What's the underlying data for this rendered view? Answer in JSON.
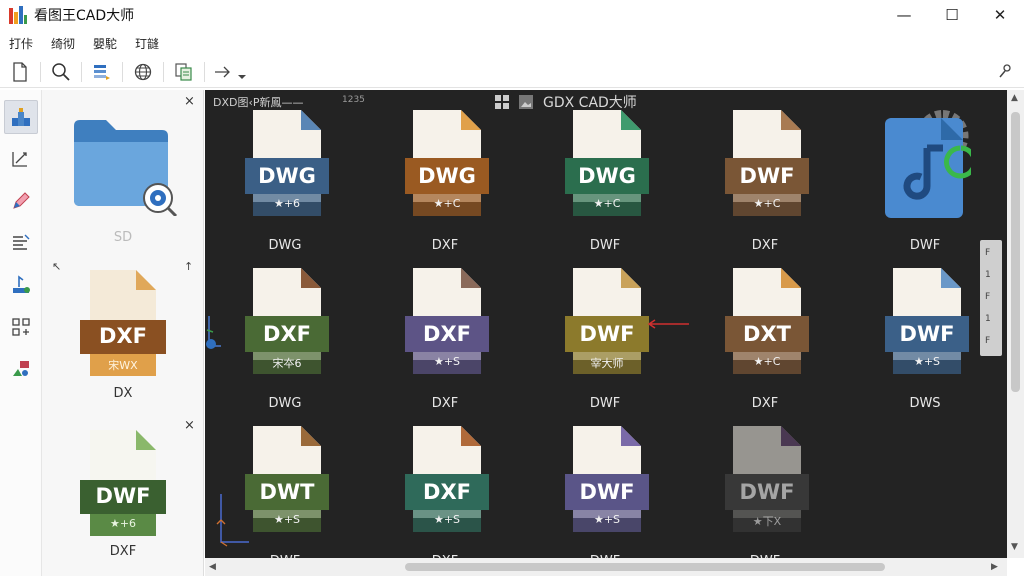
{
  "app": {
    "title": "看图王CAD大师"
  },
  "window_controls": {
    "minimize": "—",
    "maximize": "☐",
    "close": "✕"
  },
  "menu": {
    "items": [
      "打佧",
      "绮彻",
      "嬰駝",
      "玎韼"
    ]
  },
  "toolbar": {
    "buttons": [
      {
        "icon": "new-document-icon"
      },
      {
        "icon": "search-icon"
      },
      {
        "icon": "layers-icon"
      },
      {
        "icon": "globe-icon"
      },
      {
        "icon": "copy-icon"
      },
      {
        "icon": "arrow-right-icon"
      },
      {
        "icon": "dropdown-caret-icon"
      }
    ],
    "right_icon": "user-pin-icon"
  },
  "left_tools": [
    {
      "icon": "layers-blocks-icon",
      "active": true
    },
    {
      "icon": "measure-icon"
    },
    {
      "icon": "pencil-icon"
    },
    {
      "icon": "text-align-icon"
    },
    {
      "icon": "upload-icon"
    },
    {
      "icon": "grid-icon"
    },
    {
      "icon": "shapes-icon"
    }
  ],
  "side_panel": {
    "close_1": "×",
    "close_2": "×",
    "folder_label": "SD",
    "thumb_1_badge": "DXF",
    "thumb_1_sub": "宋WX",
    "thumb_1_label": "DX",
    "thumb_2_badge": "DWF",
    "thumb_2_sub": "★+6",
    "thumb_2_label": "DXF",
    "arrow_up_left": "↖",
    "arrow_up_right": "↑"
  },
  "canvas": {
    "header_text": "DXD图‹P新鳳——",
    "header_sub": "1235",
    "center_title": "GDX CAD大师",
    "grid": [
      {
        "badge": "DWG",
        "sub": "★+6",
        "label": "DWG",
        "color": "#3b5f86",
        "corner": "#5a86b5"
      },
      {
        "badge": "DWG",
        "sub": "★+C",
        "label": "DXF",
        "color": "#9a5a22",
        "corner": "#e0a04a"
      },
      {
        "badge": "DWG",
        "sub": "★+C",
        "label": "DWF",
        "color": "#2b6e4e",
        "corner": "#3f9b6e"
      },
      {
        "badge": "DWF",
        "sub": "★+C",
        "label": "DXF",
        "color": "#7a5636",
        "corner": "#a87a52"
      },
      {
        "badge": "",
        "sub": "",
        "label": "DWF",
        "color": "#4a86c8",
        "corner": "#4a86c8",
        "special": "blue-note"
      },
      {
        "badge": "DXF",
        "sub": "宋夲6",
        "label": "DWG",
        "color": "#4a6a35",
        "corner": "#8a5a3a"
      },
      {
        "badge": "DXF",
        "sub": "★+S",
        "label": "DXF",
        "color": "#5d5486",
        "corner": "#8a6a5a"
      },
      {
        "badge": "DWF",
        "sub": "宰大师",
        "label": "DWF",
        "color": "#8c7a2c",
        "corner": "#c9a25a"
      },
      {
        "badge": "DXT",
        "sub": "★+C",
        "label": "DXF",
        "color": "#7a5636",
        "corner": "#d89a4a"
      },
      {
        "badge": "DWF",
        "sub": "★+S",
        "label": "DWS",
        "color": "#3b6088",
        "corner": "#6a98c8"
      },
      {
        "badge": "DWT",
        "sub": "★+S",
        "label": "DWF",
        "color": "#4a6a35",
        "corner": "#9a6a3a"
      },
      {
        "badge": "DXF",
        "sub": "★+S",
        "label": "DXF",
        "color": "#2f6a5a",
        "corner": "#b06a3a"
      },
      {
        "badge": "DWF",
        "sub": "★+S",
        "label": "DWF",
        "color": "#5a5588",
        "corner": "#7a6aa8"
      },
      {
        "badge": "DWF",
        "sub": "★下X",
        "label": "DWF",
        "color": "#4a4a4a",
        "corner": "#6a4a7a",
        "faded": true
      }
    ],
    "ruler_marks": [
      "F",
      "1",
      "F",
      "1",
      "F"
    ]
  },
  "scroll": {
    "up": "▲",
    "down": "▼",
    "left": "◀",
    "right": "▶"
  }
}
